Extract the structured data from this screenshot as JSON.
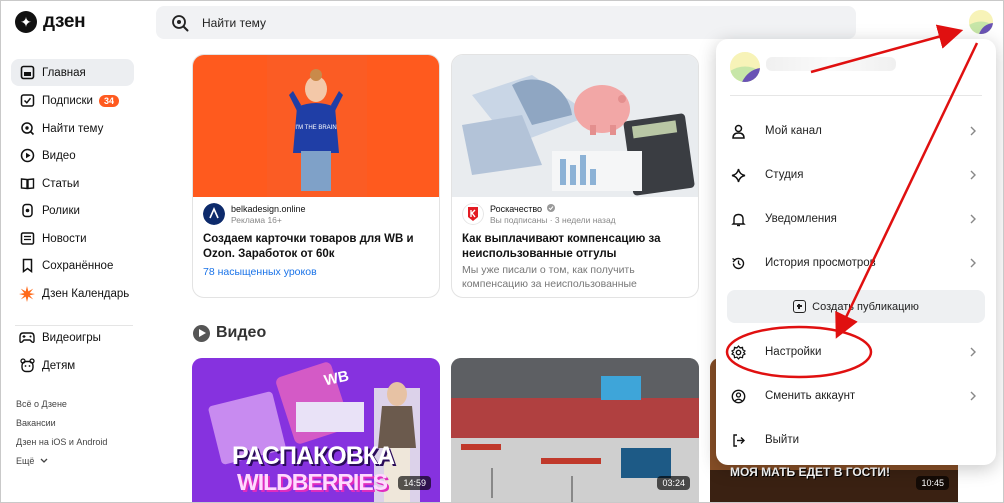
{
  "header": {
    "logo_text": "дзен",
    "search_placeholder": "Найти тему"
  },
  "sidebar": {
    "items": [
      {
        "label": "Главная"
      },
      {
        "label": "Подписки",
        "badge": "34"
      },
      {
        "label": "Найти тему"
      },
      {
        "label": "Видео"
      },
      {
        "label": "Статьи"
      },
      {
        "label": "Ролики"
      },
      {
        "label": "Новости"
      },
      {
        "label": "Сохранённое"
      },
      {
        "label": "Дзен Календарь"
      },
      {
        "label": "Видеоигры"
      },
      {
        "label": "Детям"
      }
    ],
    "footer": [
      "Всё о Дзене",
      "Вакансии",
      "Дзен на iOS и Android",
      "Ещё"
    ]
  },
  "cards": [
    {
      "source": "belkadesign.online",
      "meta": "Реклама 16+",
      "title": "Создаем карточки товаров для WB и Ozon. Заработок от 60к",
      "link": "78 насыщенных уроков"
    },
    {
      "source": "Роскачество",
      "meta": "Вы подписаны · 3 недели назад",
      "title": "Как выплачивают компенсацию за неиспользованные отгулы",
      "desc": "Мы уже писали о том, как получить компенсацию за неиспользованные"
    }
  ],
  "video_section": {
    "title": "Видео",
    "videos": [
      {
        "overlay_top": "WB",
        "overlay_line1": "РАСПАКОВКА",
        "overlay_line2": "WILDBERRIES",
        "duration": "14:59"
      },
      {
        "duration": "03:24"
      },
      {
        "overlay": "МОЯ МАТЬ ЕДЕТ В ГОСТИ!",
        "duration": "10:45"
      }
    ]
  },
  "dropdown": {
    "items": [
      {
        "label": "Мой канал"
      },
      {
        "label": "Студия"
      },
      {
        "label": "Уведомления"
      },
      {
        "label": "История просмотров"
      },
      {
        "label": "Настройки"
      },
      {
        "label": "Сменить аккаунт"
      },
      {
        "label": "Выйти"
      }
    ],
    "create_label": "Создать публикацию"
  },
  "colors": {
    "accent": "#ff5a1f",
    "link": "#1a73e8",
    "annotation": "#e01010"
  }
}
